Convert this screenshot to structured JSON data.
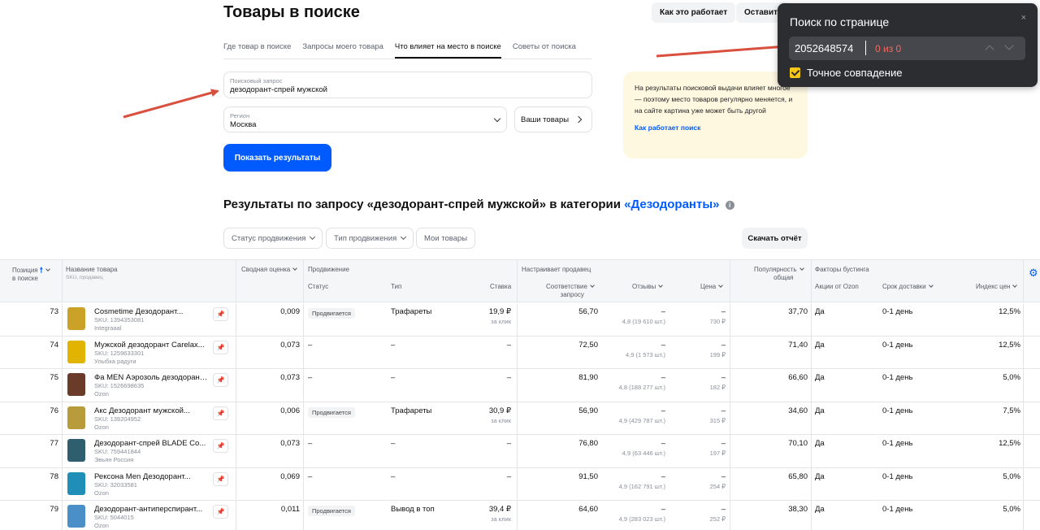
{
  "header": {
    "title": "Товары в поиске",
    "how_it_works": "Как это работает",
    "leave": "Оставить"
  },
  "tabs": [
    "Где товар в поиске",
    "Запросы моего товара",
    "Что влияет на место в поиске",
    "Советы от поиска"
  ],
  "search": {
    "query_label": "Поисковый запрос",
    "query_value": "дезодорант-спрей мужской",
    "region_label": "Регион",
    "region_value": "Москва",
    "your_goods": "Ваши товары",
    "submit": "Показать результаты"
  },
  "note": {
    "text": "На результаты поисковой выдачи влияет многое — поэтому место товаров регулярно меняется, и на сайте картина уже может быть другой",
    "link": "Как работает поиск"
  },
  "results": {
    "heading_prefix": "Результаты по запросу «дезодорант-спрей мужской» в категории",
    "category": "«Дезодоранты»",
    "info": "i"
  },
  "filters": [
    "Статус продвижения",
    "Тип продвижения",
    "Мои товары"
  ],
  "download": "Скачать отчёт",
  "columns": {
    "position": "Позиция",
    "position_sub": "в поиске",
    "name": "Название товара",
    "name_sub": "SKU, продавец",
    "score": "Сводная оценка",
    "promo": "Продвижение",
    "status": "Статус",
    "type": "Тип",
    "bid": "Ставка",
    "seller_group": "Настраивает продавец",
    "relevance": "Соответствие",
    "relevance2": "запросу",
    "reviews": "Отзывы",
    "price": "Цена",
    "popularity": "Популярность",
    "popularity2": "общая",
    "boost": "Факторы бустинга",
    "ozon_promo": "Акции от Ozon",
    "delivery": "Срок доставки",
    "price_index": "Индекс цен"
  },
  "rows": [
    {
      "pos": "73",
      "name": "Cosmetime Дезодорант...",
      "sku": "SKU: 1394353081",
      "seller": "Integraaal",
      "score": "0,009",
      "status": "Продвигается",
      "type": "Трафареты",
      "bid": "19,9 ₽",
      "bid_sub": "за клик",
      "relevance": "56,70",
      "reviews": "–",
      "reviews_sub": "4,8 (19 610 шт.)",
      "price": "–",
      "price_sub": "730 ₽",
      "popularity": "37,70",
      "ozon_promo": "Да",
      "delivery": "0-1 день",
      "price_index": "12,5%",
      "thumb": "#c9a227"
    },
    {
      "pos": "74",
      "name": "Мужской дезодорант Carelax...",
      "sku": "SKU: 1259633301",
      "seller": "Улыбка радуги",
      "score": "0,073",
      "status": "–",
      "type": "–",
      "bid": "–",
      "bid_sub": "",
      "relevance": "72,50",
      "reviews": "–",
      "reviews_sub": "4,9 (1 573 шт.)",
      "price": "–",
      "price_sub": "199 ₽",
      "popularity": "71,40",
      "ozon_promo": "Да",
      "delivery": "0-1 день",
      "price_index": "12,5%",
      "thumb": "#e0b400"
    },
    {
      "pos": "75",
      "name": "Фа MEN Аэрозоль дезодорант...",
      "sku": "SKU: 1526698635",
      "seller": "Ozon",
      "score": "0,073",
      "status": "–",
      "type": "–",
      "bid": "–",
      "bid_sub": "",
      "relevance": "81,90",
      "reviews": "–",
      "reviews_sub": "4,8 (188 277 шт.)",
      "price": "–",
      "price_sub": "182 ₽",
      "popularity": "66,60",
      "ozon_promo": "Да",
      "delivery": "0-1 день",
      "price_index": "5,0%",
      "thumb": "#6b3b2a"
    },
    {
      "pos": "76",
      "name": "Акс Дезодорант мужской...",
      "sku": "SKU: 139204952",
      "seller": "Ozon",
      "score": "0,006",
      "status": "Продвигается",
      "type": "Трафареты",
      "bid": "30,9 ₽",
      "bid_sub": "за клик",
      "relevance": "56,90",
      "reviews": "–",
      "reviews_sub": "4,9 (429 787 шт.)",
      "price": "–",
      "price_sub": "315 ₽",
      "popularity": "34,60",
      "ozon_promo": "Да",
      "delivery": "0-1 день",
      "price_index": "7,5%",
      "thumb": "#b89b3a"
    },
    {
      "pos": "77",
      "name": "Дезодорант-спрей BLADE Co...",
      "sku": "SKU: 759441844",
      "seller": "Эвьян Россия",
      "score": "0,073",
      "status": "–",
      "type": "–",
      "bid": "–",
      "bid_sub": "",
      "relevance": "76,80",
      "reviews": "–",
      "reviews_sub": "4,9 (63 446 шт.)",
      "price": "–",
      "price_sub": "197 ₽",
      "popularity": "70,10",
      "ozon_promo": "Да",
      "delivery": "0-1 день",
      "price_index": "12,5%",
      "thumb": "#2f5f6e"
    },
    {
      "pos": "78",
      "name": "Рексона Men Дезодорант...",
      "sku": "SKU: 32033581",
      "seller": "Ozon",
      "score": "0,069",
      "status": "–",
      "type": "–",
      "bid": "–",
      "bid_sub": "",
      "relevance": "91,50",
      "reviews": "–",
      "reviews_sub": "4,9 (162 791 шт.)",
      "price": "–",
      "price_sub": "254 ₽",
      "popularity": "65,80",
      "ozon_promo": "Да",
      "delivery": "0-1 день",
      "price_index": "5,0%",
      "thumb": "#1f8fb8"
    },
    {
      "pos": "79",
      "name": "Дезодорант-антиперспирант...",
      "sku": "SKU: 5044015",
      "seller": "Ozon",
      "score": "0,011",
      "status": "Продвигается",
      "type": "Вывод в топ",
      "bid": "39,4 ₽",
      "bid_sub": "за клик",
      "relevance": "64,60",
      "reviews": "–",
      "reviews_sub": "4,9 (283 023 шт.)",
      "price": "–",
      "price_sub": "252 ₽",
      "popularity": "38,30",
      "ozon_promo": "Да",
      "delivery": "0-1 день",
      "price_index": "5,0%",
      "thumb": "#4a8fc7"
    }
  ],
  "find_bar": {
    "title": "Поиск по странице",
    "query": "2052648574",
    "count": "0 из 0",
    "exact": "Точное совпадение",
    "close": "×"
  },
  "colors": {
    "accent": "#005bff",
    "annotation_arrow": "#d9503f",
    "note_bg": "#fff8e1"
  }
}
